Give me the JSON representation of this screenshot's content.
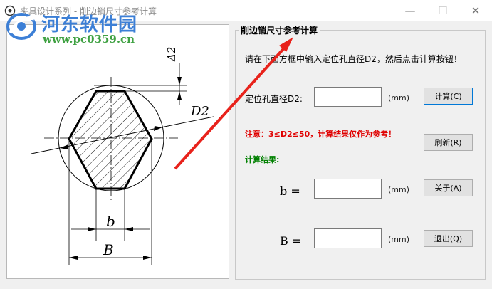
{
  "window": {
    "title": "夹具设计系列 - 削边销尺寸参考计算",
    "minimize_glyph": "—",
    "maximize_glyph": "☐",
    "close_glyph": "✕"
  },
  "watermark": {
    "name": "河东软件园",
    "url": "www.pc0359.cn"
  },
  "diagram": {
    "labels": {
      "delta": "Δ2",
      "D": "D2",
      "b": "b",
      "B": "B"
    }
  },
  "panel": {
    "title": "削边销尺寸参考计算",
    "instruction": "请在下面方框中输入定位孔直径D2，然后点击计算按钮！",
    "input_label": "定位孔直径D2:",
    "input_value": "",
    "unit": "(mm)",
    "note": "注意：3≤D2≤50，计算结果仅作为参考！",
    "result_label": "计算结果:",
    "b_label": "b =",
    "b_value": "",
    "B_label": "B =",
    "B_value": ""
  },
  "buttons": {
    "calculate": "计算(C)",
    "refresh": "刷新(R)",
    "about": "关于(A)",
    "exit": "退出(Q)"
  },
  "colors": {
    "arrow": "#e8221b",
    "note": "#e00000",
    "result": "#008000",
    "watermark": "#3c7fd6"
  }
}
